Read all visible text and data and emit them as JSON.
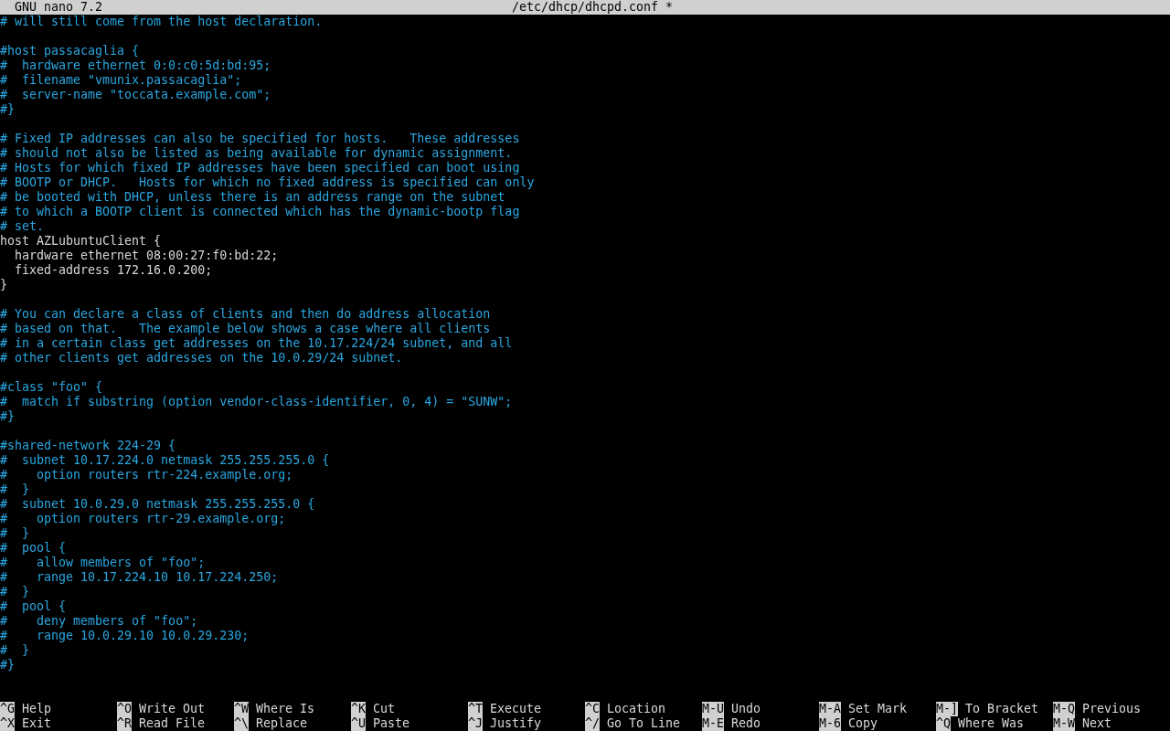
{
  "title_bar": {
    "app": "GNU nano 7.2",
    "file": "/etc/dhcp/dhcpd.conf *"
  },
  "lines": [
    {
      "kind": "comment",
      "text": "# will still come from the host declaration."
    },
    {
      "kind": "blank"
    },
    {
      "kind": "comment",
      "text": "#host passacaglia {"
    },
    {
      "kind": "comment",
      "text": "#  hardware ethernet 0:0:c0:5d:bd:95;"
    },
    {
      "kind": "comment",
      "text": "#  filename \"vmunix.passacaglia\";"
    },
    {
      "kind": "comment",
      "text": "#  server-name \"toccata.example.com\";"
    },
    {
      "kind": "comment",
      "text": "#}"
    },
    {
      "kind": "blank"
    },
    {
      "kind": "comment",
      "text": "# Fixed IP addresses can also be specified for hosts.   These addresses"
    },
    {
      "kind": "comment",
      "text": "# should not also be listed as being available for dynamic assignment."
    },
    {
      "kind": "comment",
      "text": "# Hosts for which fixed IP addresses have been specified can boot using"
    },
    {
      "kind": "comment",
      "text": "# BOOTP or DHCP.   Hosts for which no fixed address is specified can only"
    },
    {
      "kind": "comment",
      "text": "# be booted with DHCP, unless there is an address range on the subnet"
    },
    {
      "kind": "comment",
      "text": "# to which a BOOTP client is connected which has the dynamic-bootp flag"
    },
    {
      "kind": "comment",
      "text": "# set."
    },
    {
      "kind": "code",
      "text": "host AZLubuntuClient {"
    },
    {
      "kind": "code",
      "text": "  hardware ethernet 08:00:27:f0:bd:22;"
    },
    {
      "kind": "code",
      "text": "  fixed-address 172.16.0.200;"
    },
    {
      "kind": "code",
      "text": "}"
    },
    {
      "kind": "blank"
    },
    {
      "kind": "comment",
      "text": "# You can declare a class of clients and then do address allocation"
    },
    {
      "kind": "comment",
      "text": "# based on that.   The example below shows a case where all clients"
    },
    {
      "kind": "comment",
      "text": "# in a certain class get addresses on the 10.17.224/24 subnet, and all"
    },
    {
      "kind": "comment",
      "text": "# other clients get addresses on the 10.0.29/24 subnet."
    },
    {
      "kind": "blank"
    },
    {
      "kind": "comment",
      "text": "#class \"foo\" {"
    },
    {
      "kind": "comment",
      "text": "#  match if substring (option vendor-class-identifier, 0, 4) = \"SUNW\";"
    },
    {
      "kind": "comment",
      "text": "#}"
    },
    {
      "kind": "blank"
    },
    {
      "kind": "comment",
      "text": "#shared-network 224-29 {"
    },
    {
      "kind": "comment",
      "text": "#  subnet 10.17.224.0 netmask 255.255.255.0 {"
    },
    {
      "kind": "comment",
      "text": "#    option routers rtr-224.example.org;"
    },
    {
      "kind": "comment",
      "text": "#  }"
    },
    {
      "kind": "comment",
      "text": "#  subnet 10.0.29.0 netmask 255.255.255.0 {"
    },
    {
      "kind": "comment",
      "text": "#    option routers rtr-29.example.org;"
    },
    {
      "kind": "comment",
      "text": "#  }"
    },
    {
      "kind": "comment",
      "text": "#  pool {"
    },
    {
      "kind": "comment",
      "text": "#    allow members of \"foo\";"
    },
    {
      "kind": "comment",
      "text": "#    range 10.17.224.10 10.17.224.250;"
    },
    {
      "kind": "comment",
      "text": "#  }"
    },
    {
      "kind": "comment",
      "text": "#  pool {"
    },
    {
      "kind": "comment",
      "text": "#    deny members of \"foo\";"
    },
    {
      "kind": "comment",
      "text": "#    range 10.0.29.10 10.0.29.230;"
    },
    {
      "kind": "comment",
      "text": "#  }"
    },
    {
      "kind": "comment",
      "text": "#}"
    }
  ],
  "shortcuts": [
    [
      {
        "key": "^G",
        "label": "Help"
      },
      {
        "key": "^O",
        "label": "Write Out"
      },
      {
        "key": "^W",
        "label": "Where Is"
      },
      {
        "key": "^K",
        "label": "Cut"
      },
      {
        "key": "^T",
        "label": "Execute"
      },
      {
        "key": "^C",
        "label": "Location"
      },
      {
        "key": "M-U",
        "label": "Undo"
      },
      {
        "key": "M-A",
        "label": "Set Mark"
      },
      {
        "key": "M-]",
        "label": "To Bracket"
      },
      {
        "key": "M-Q",
        "label": "Previous"
      }
    ],
    [
      {
        "key": "^X",
        "label": "Exit"
      },
      {
        "key": "^R",
        "label": "Read File"
      },
      {
        "key": "^\\",
        "label": "Replace"
      },
      {
        "key": "^U",
        "label": "Paste"
      },
      {
        "key": "^J",
        "label": "Justify"
      },
      {
        "key": "^/",
        "label": "Go To Line"
      },
      {
        "key": "M-E",
        "label": "Redo"
      },
      {
        "key": "M-6",
        "label": "Copy"
      },
      {
        "key": "^Q",
        "label": "Where Was"
      },
      {
        "key": "M-W",
        "label": "Next"
      }
    ]
  ]
}
